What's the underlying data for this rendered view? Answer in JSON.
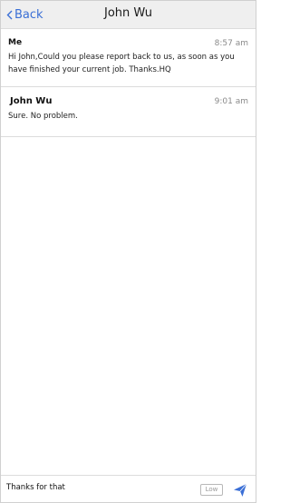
{
  "header": {
    "back_label": "Back",
    "title": "John Wu"
  },
  "messages": [
    {
      "sender": "Me",
      "time": "8:57 am",
      "text": "Hi John,Could you please report back to us, as soon as you have finished your current job. Thanks.HQ"
    },
    {
      "sender": "John Wu",
      "time": "9:01 am",
      "text": "Sure. No problem."
    }
  ],
  "composer": {
    "value": "Thanks for that",
    "priority_label": "Low"
  },
  "icons": {
    "back": "chevron-left-icon",
    "send": "send-icon"
  },
  "colors": {
    "accent": "#3a6fd6",
    "header_bg": "#efefef"
  }
}
